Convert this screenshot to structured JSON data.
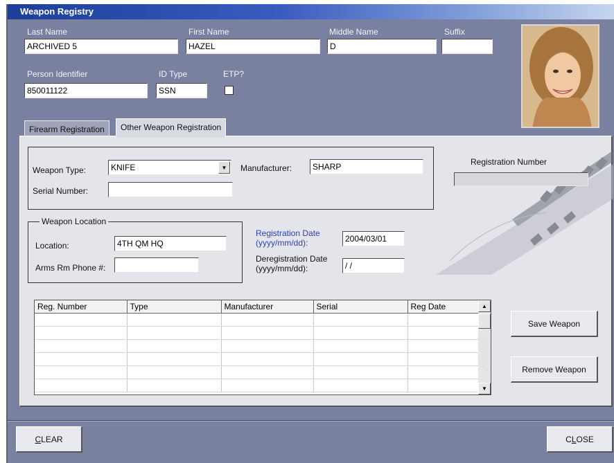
{
  "window": {
    "title": "Weapon Registry"
  },
  "person": {
    "last_name_label": "Last Name",
    "last_name_value": "ARCHIVED 5",
    "first_name_label": "First Name",
    "first_name_value": "HAZEL",
    "middle_name_label": "Middle Name",
    "middle_name_value": "D",
    "suffix_label": "Suffix",
    "suffix_value": "",
    "person_id_label": "Person Identifier",
    "person_id_value": "850011122",
    "id_type_label": "ID Type",
    "id_type_value": "SSN",
    "etp_label": "ETP?",
    "etp_checked": false
  },
  "tabs": [
    {
      "label": "Firearm Registration",
      "active": false
    },
    {
      "label": "Other Weapon Registration",
      "active": true
    }
  ],
  "weapon": {
    "type_label": "Weapon Type:",
    "type_value": "KNIFE",
    "manufacturer_label": "Manufacturer:",
    "manufacturer_value": "SHARP",
    "serial_label": "Serial Number:",
    "serial_value": "",
    "reg_number_label": "Registration Number",
    "reg_number_value": ""
  },
  "location": {
    "group_label": "Weapon Location",
    "location_label": "Location:",
    "location_value": "4TH QM HQ",
    "phone_label": "Arms Rm Phone #:",
    "phone_value": ""
  },
  "dates": {
    "reg_label": "Registration Date",
    "reg_format": "(yyyy/mm/dd):",
    "reg_value": "2004/03/01",
    "dereg_label": "Deregistration Date",
    "dereg_format": "(yyyy/mm/dd):",
    "dereg_value": " / /"
  },
  "grid": {
    "columns": [
      "Reg. Number",
      "Type",
      "Manufacturer",
      "Serial",
      "Reg Date"
    ],
    "rows": [
      [
        "",
        "",
        "",
        "",
        ""
      ],
      [
        "",
        "",
        "",
        "",
        ""
      ],
      [
        "",
        "",
        "",
        "",
        ""
      ],
      [
        "",
        "",
        "",
        "",
        ""
      ],
      [
        "",
        "",
        "",
        "",
        ""
      ],
      [
        "",
        "",
        "",
        "",
        ""
      ]
    ]
  },
  "buttons": {
    "save_weapon": "Save Weapon",
    "remove_weapon": "Remove Weapon",
    "clear_first": "C",
    "clear_rest": "LEAR",
    "close_first": "C",
    "close_u": "L",
    "close_rest": "OSE"
  },
  "icons": {
    "dropdown": "chevron-down-icon",
    "scroll_up": "arrow-up-icon",
    "scroll_down": "arrow-down-icon"
  }
}
